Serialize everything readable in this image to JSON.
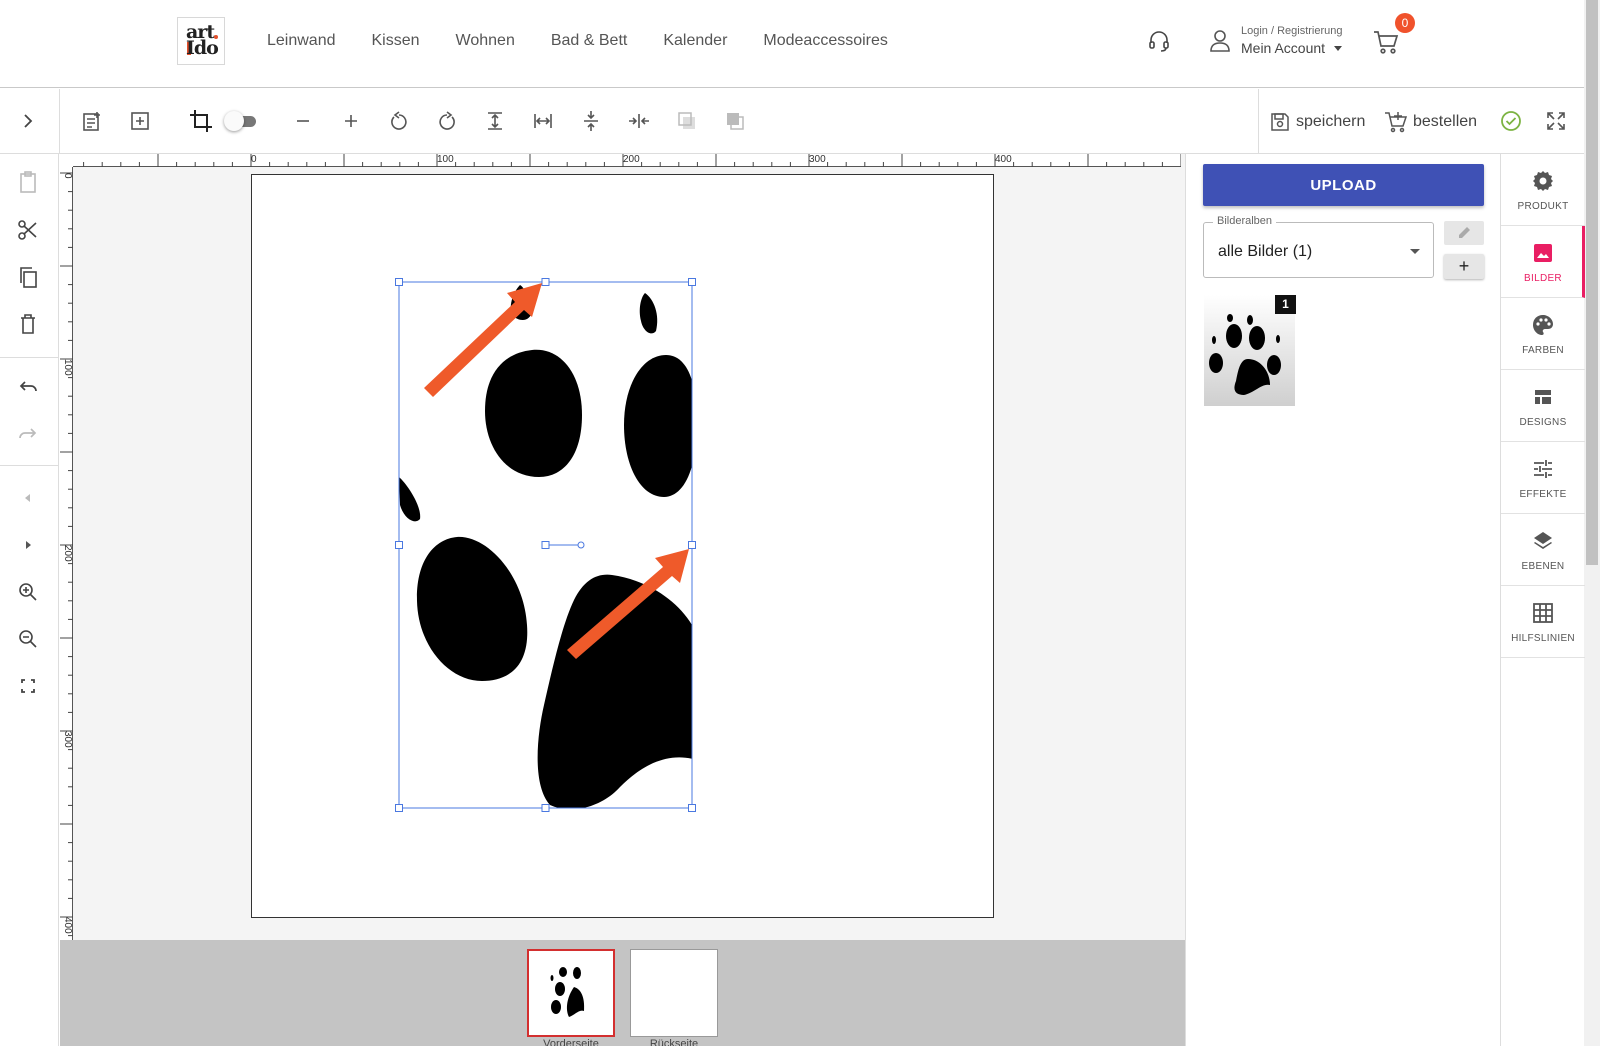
{
  "header": {
    "logo_line1": "art",
    "logo_line2": "Ido",
    "nav": [
      "Leinwand",
      "Kissen",
      "Wohnen",
      "Bad & Bett",
      "Kalender",
      "Modeaccessoires"
    ],
    "account_small": "Login / Registrierung",
    "account_big": "Mein Account",
    "cart_count": "0"
  },
  "toolbar": {
    "save_label": "speichern",
    "order_label": "bestellen",
    "confirm_color": "#7cb342"
  },
  "rulers": {
    "top": [
      "0",
      "100",
      "200",
      "300",
      "400"
    ],
    "left": [
      "0",
      "100",
      "200",
      "300",
      "400"
    ]
  },
  "pages": {
    "front_label": "Vorderseite",
    "back_label": "Rückseite"
  },
  "panel": {
    "upload_label": "UPLOAD",
    "album_label": "Bilderalben",
    "album_value": "alle Bilder (1)",
    "add_label": "+",
    "thumb_badge": "1"
  },
  "side_tabs": [
    {
      "label": "PRODUKT",
      "icon": "gear-icon"
    },
    {
      "label": "BILDER",
      "icon": "image-icon"
    },
    {
      "label": "FARBEN",
      "icon": "palette-icon"
    },
    {
      "label": "DESIGNS",
      "icon": "layout-icon"
    },
    {
      "label": "EFFEKTE",
      "icon": "tune-icon"
    },
    {
      "label": "EBENEN",
      "icon": "layers-icon"
    },
    {
      "label": "HILFSLINIEN",
      "icon": "grid-icon"
    }
  ],
  "colors": {
    "accent": "#3f51b5",
    "active_tab": "#e91e63",
    "annotation_arrow": "#ef5a2a",
    "selection": "#4a78e0"
  }
}
